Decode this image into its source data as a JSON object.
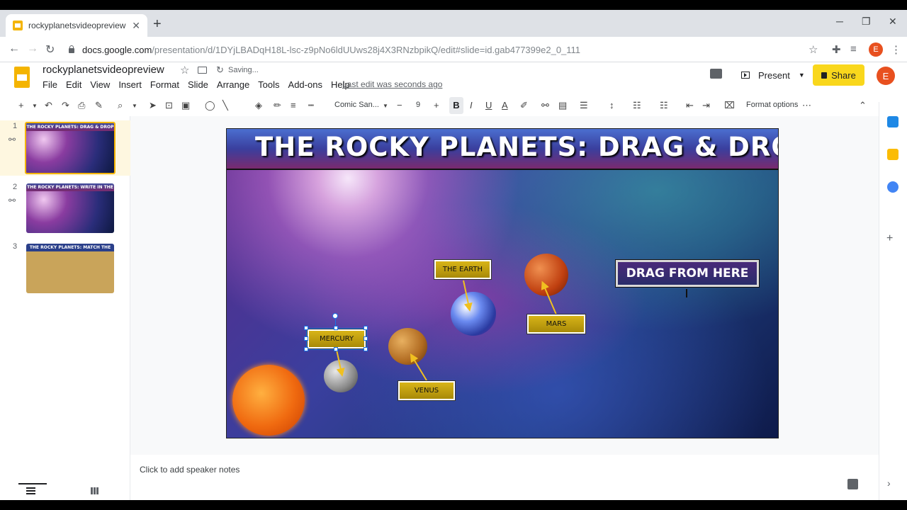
{
  "browser": {
    "tab_title": "rockyplanetsvideopreview - Goo",
    "url_host": "docs.google.com",
    "url_path": "/presentation/d/1DYjLBADqH18L-lsc-z9pNo6ldUUws28j4X3RNzbpikQ/edit#slide=id.gab477399e2_0_111",
    "profile_initial": "E"
  },
  "doc": {
    "title": "rockyplanetsvideopreview",
    "saving_status": "Saving...",
    "last_edit": "Last edit was seconds ago",
    "menu": [
      "File",
      "Edit",
      "View",
      "Insert",
      "Format",
      "Slide",
      "Arrange",
      "Tools",
      "Add-ons",
      "Help"
    ],
    "present_label": "Present",
    "share_label": "Share",
    "user_initial": "E"
  },
  "toolbar": {
    "font_name": "Comic San...",
    "font_size": "9",
    "format_options": "Format options"
  },
  "filmstrip": {
    "slides": [
      {
        "number": "1",
        "title": "THE ROCKY PLANETS: DRAG & DROP"
      },
      {
        "number": "2",
        "title": "THE ROCKY PLANETS: WRITE IN THE BOX"
      },
      {
        "number": "3",
        "title": "THE ROCKY PLANETS: MATCH THE DEFINITIONS"
      }
    ]
  },
  "slide": {
    "title": "THE ROCKY PLANETS: DRAG & DROP",
    "labels": {
      "earth": "THE EARTH",
      "mercury": "MERCURY",
      "venus": "VENUS",
      "mars": "MARS"
    },
    "drag_box": "DRAG FROM HERE"
  },
  "notes": {
    "placeholder": "Click to add speaker notes"
  },
  "colors": {
    "accent_yellow": "#f9d71c",
    "brand_slides": "#f4b400",
    "selection_blue": "#1a73e8",
    "avatar_orange": "#e8501f"
  }
}
